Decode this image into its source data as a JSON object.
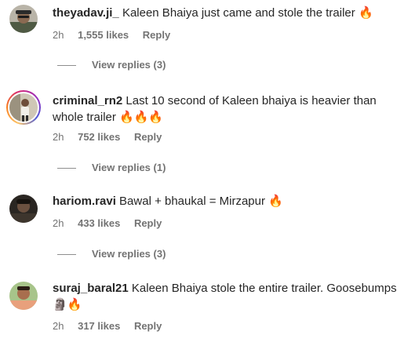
{
  "comments": [
    {
      "username": "theyadav.ji_",
      "text": "Kaleen Bhaiya just came and stole the trailer 🔥",
      "time": "2h",
      "likes": "1,555 likes",
      "reply_label": "Reply",
      "view_replies": "View replies (3)"
    },
    {
      "username": "criminal_rn2",
      "text": "Last 10 second of Kaleen bhaiya is heavier than whole trailer 🔥🔥🔥",
      "time": "2h",
      "likes": "752 likes",
      "reply_label": "Reply",
      "view_replies": "View replies (1)"
    },
    {
      "username": "hariom.ravi",
      "text": "Bawal + bhaukal = Mirzapur 🔥",
      "time": "2h",
      "likes": "433 likes",
      "reply_label": "Reply",
      "view_replies": "View replies (3)"
    },
    {
      "username": "suraj_baral21",
      "text": "Kaleen Bhaiya stole the entire trailer. Goosebumps 🗿🔥",
      "time": "2h",
      "likes": "317 likes",
      "reply_label": "Reply"
    }
  ],
  "colors": {
    "primary_text": "#262626",
    "secondary_text": "#737373",
    "story_ring": [
      "#fdc468",
      "#fa7e1e",
      "#d62976",
      "#962fbf",
      "#4f5bd5"
    ]
  }
}
